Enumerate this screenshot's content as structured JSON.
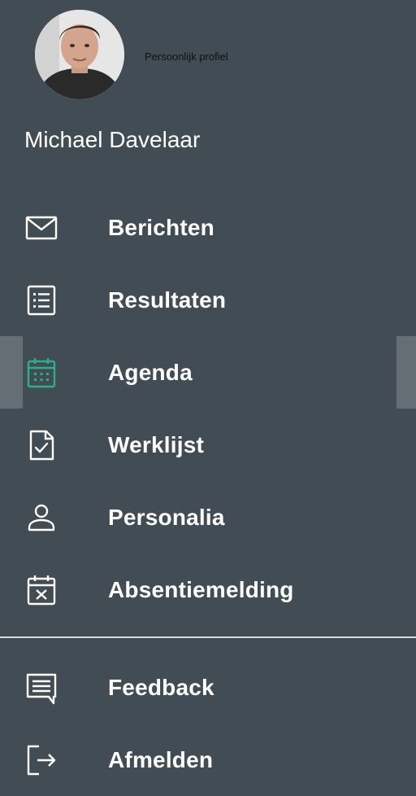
{
  "profile": {
    "link_label": "Persoonlijk profiel",
    "name": "Michael Davelaar"
  },
  "nav": {
    "items": [
      {
        "label": "Berichten",
        "icon": "envelope-icon"
      },
      {
        "label": "Resultaten",
        "icon": "list-icon"
      },
      {
        "label": "Agenda",
        "icon": "calendar-icon",
        "active": true
      },
      {
        "label": "Werklijst",
        "icon": "document-check-icon"
      },
      {
        "label": "Personalia",
        "icon": "person-icon"
      },
      {
        "label": "Absentiemelding",
        "icon": "calendar-x-icon"
      }
    ],
    "footer": [
      {
        "label": "Feedback",
        "icon": "feedback-icon"
      },
      {
        "label": "Afmelden",
        "icon": "logout-icon"
      }
    ]
  },
  "colors": {
    "background": "#424c54",
    "accent": "#2bb08a",
    "active_highlight": "#656e75",
    "divider": "#d8dadc"
  }
}
